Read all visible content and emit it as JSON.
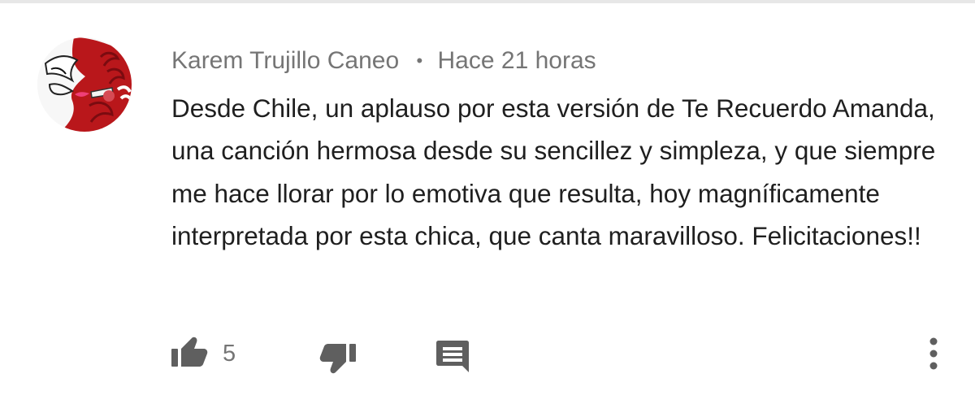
{
  "comment": {
    "author": "Karem Trujillo Caneo",
    "separator": "•",
    "time": "Hace 21 horas",
    "text": "Desde Chile, un aplauso por esta versión de Te Recuerdo Amanda, una canción hermosa desde su sencillez y simpleza, y que siempre me hace llorar por lo emotiva que resulta, hoy magníficamente interpretada por esta chica, que canta maravilloso. Felicitaciones!!"
  },
  "actions": {
    "like_icon": "thumb-up-icon",
    "like_count": "5",
    "dislike_icon": "thumb-down-icon",
    "reply_icon": "comment-icon",
    "menu_icon": "more-vertical-icon"
  },
  "colors": {
    "text": "#1f1f1f",
    "secondary_text": "#757575",
    "icon": "#5f5f5f",
    "avatar_red": "#b9171b",
    "divider": "#e7e7e7"
  }
}
